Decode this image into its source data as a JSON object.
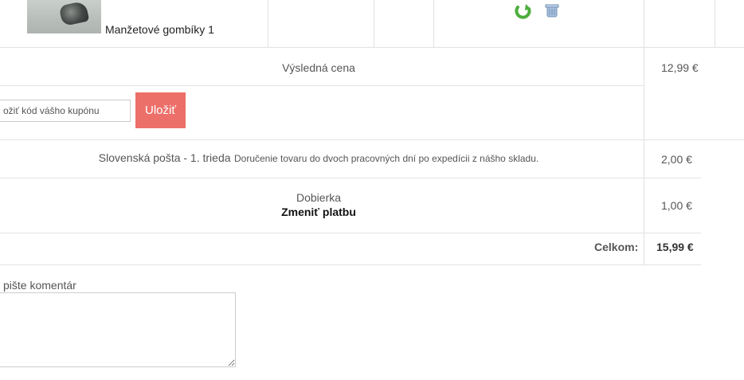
{
  "product": {
    "name": "Manžetové gombíky 1",
    "thumbnail_icon": "cufflinks-product-image",
    "refresh_icon": "refresh-icon",
    "remove_icon": "remove-icon"
  },
  "summary": {
    "subtotal_label": "Výsledná cena",
    "subtotal_value": "12,99 €",
    "total_label": "Celkom:",
    "total_value": "15,99 €"
  },
  "coupon": {
    "placeholder": "ožiť kód vášho kupónu",
    "save_label": "Uložiť"
  },
  "shipping": {
    "name": "Slovenská pošta - 1. trieda",
    "description": "Doručenie tovaru do dvoch pracovných dní po expedícii z nášho skladu.",
    "price": "2,00 €"
  },
  "payment": {
    "name": "Dobierka",
    "change_label": "Zmeniť platbu",
    "price": "1,00 €"
  },
  "comment": {
    "label": "pište komentár",
    "value": ""
  },
  "colors": {
    "save_button": "#ec6f69",
    "refresh_icon": "#4cae3c",
    "border": "#e2e2e2"
  }
}
